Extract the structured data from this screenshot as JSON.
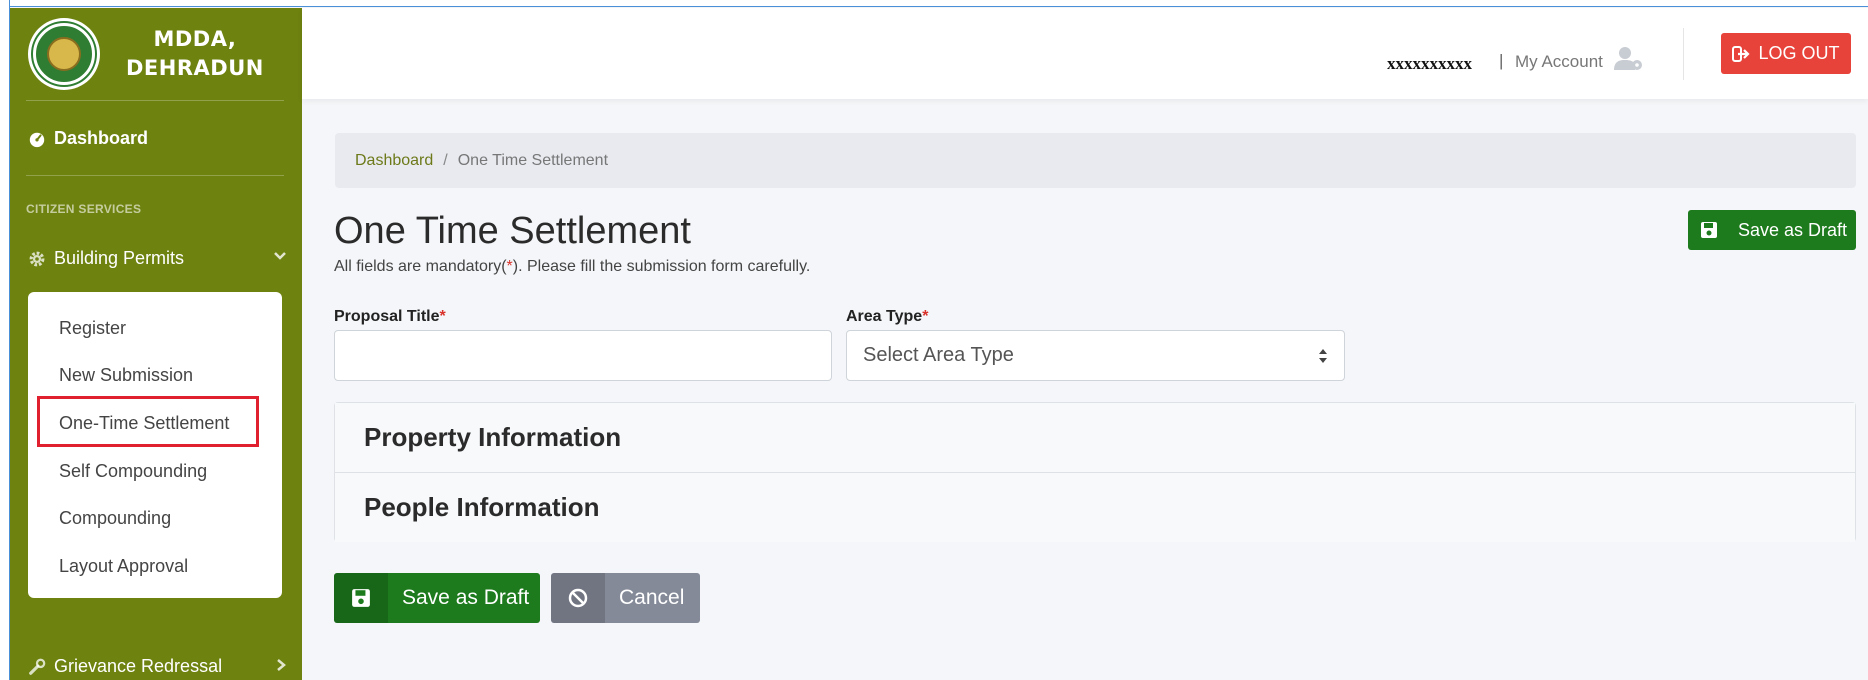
{
  "brand": {
    "line1": "MDDA,",
    "line2": "DEHRADUN"
  },
  "sidebar": {
    "dashboard": "Dashboard",
    "section": "CITIZEN SERVICES",
    "building_permits": "Building Permits",
    "submenu": [
      "Register",
      "New Submission",
      "One-Time Settlement",
      "Self Compounding",
      "Compounding",
      "Layout Approval"
    ],
    "grievance": "Grievance Redressal"
  },
  "header": {
    "username": "xxxxxxxxxx",
    "separator": "|",
    "my_account": "My Account",
    "logout": "LOG OUT"
  },
  "breadcrumb": {
    "home": "Dashboard",
    "separator": "/",
    "current": "One Time Settlement"
  },
  "page": {
    "title": "One Time Settlement",
    "subtitle_pre": "All fields are mandatory(",
    "subtitle_star": "*",
    "subtitle_post": "). Please fill the submission form carefully.",
    "save_draft_top": "Save as Draft"
  },
  "form": {
    "proposal_title_label": "Proposal Title",
    "area_type_label": "Area Type",
    "required_mark": "*",
    "proposal_title_value": "",
    "area_type_placeholder": "Select Area Type"
  },
  "accordion": [
    "Property Information",
    "People Information"
  ],
  "actions": {
    "save_draft": "Save as Draft",
    "cancel": "Cancel"
  },
  "colors": {
    "sidebar": "#6e8210",
    "primary_green": "#1d7a1d",
    "logout_red": "#e8433b",
    "highlight": "#e0202e"
  }
}
